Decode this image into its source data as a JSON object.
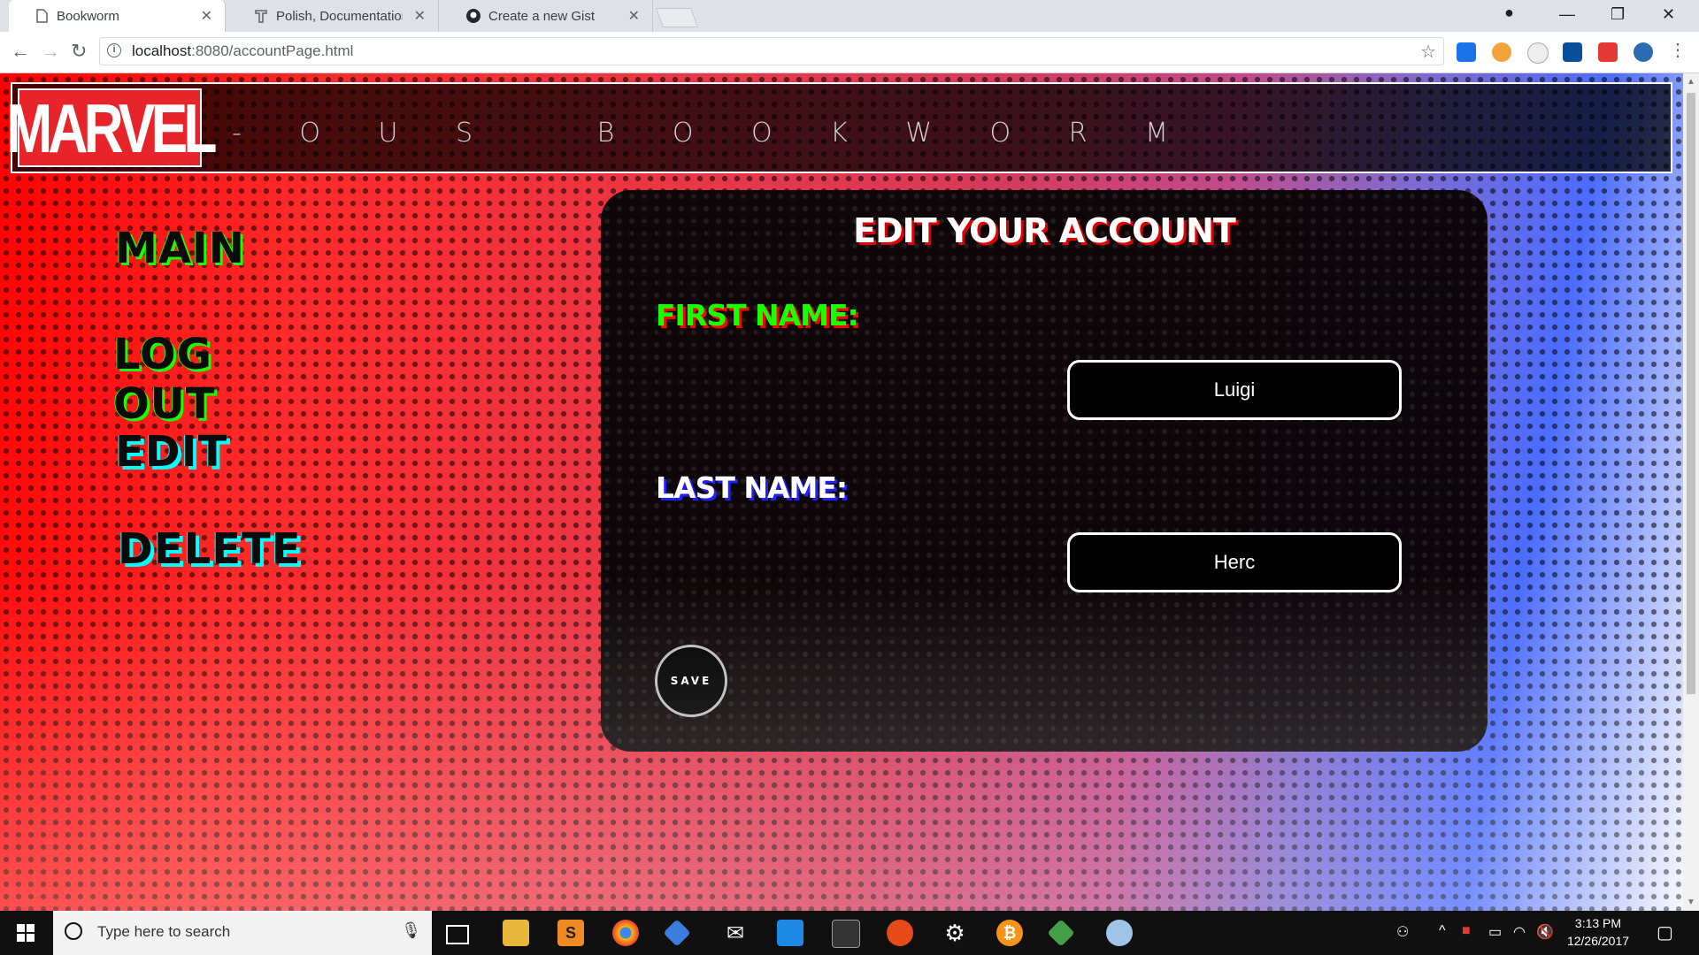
{
  "browser": {
    "tabs": [
      {
        "title": "Bookworm",
        "active": true
      },
      {
        "title": "Polish, Documentation, a",
        "active": false
      },
      {
        "title": "Create a new Gist",
        "active": false
      }
    ],
    "url_host": "localhost",
    "url_path": ":8080/accountPage.html"
  },
  "header": {
    "logo": "MARVEL",
    "tagline": "- O U S   B O O K W O R M"
  },
  "nav": {
    "main": "MAIN",
    "logout": "LOG OUT",
    "edit": "EDIT",
    "delete": "DELETE"
  },
  "form": {
    "title": "EDIT YOUR ACCOUNT",
    "first_name_label": "FIRST NAME:",
    "first_name_value": "Luigi",
    "last_name_label": "LAST NAME:",
    "last_name_value": "Herc",
    "save_label": "SAVE"
  },
  "taskbar": {
    "search_placeholder": "Type here to search",
    "time": "3:13 PM",
    "date": "12/26/2017"
  },
  "colors": {
    "marvel_red": "#e62429",
    "nav_green": "#19ff00",
    "nav_cyan": "#00ffff"
  }
}
